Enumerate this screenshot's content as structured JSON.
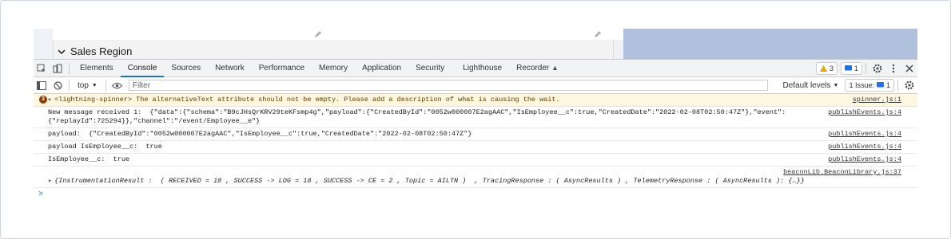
{
  "page": {
    "section_title": "Sales Region"
  },
  "devtools": {
    "tabs": [
      {
        "label": "Elements"
      },
      {
        "label": "Console"
      },
      {
        "label": "Sources"
      },
      {
        "label": "Network"
      },
      {
        "label": "Performance"
      },
      {
        "label": "Memory"
      },
      {
        "label": "Application"
      },
      {
        "label": "Security"
      },
      {
        "label": "Lighthouse"
      },
      {
        "label": "Recorder"
      }
    ],
    "warnings_count": "3",
    "messages_count": "1",
    "toolbar": {
      "context": "top",
      "filter_placeholder": "Filter",
      "levels_label": "Default levels",
      "issue_label": "1 Issue:",
      "issue_count": "1"
    },
    "console": {
      "warning": {
        "count": "3",
        "text": "<lightning-spinner> The alternativeText attribute should not be empty. Please add a description of what is causing the wait.",
        "source": "spinner.js:1"
      },
      "rows": [
        {
          "text": "New message received 1:  {\"data\":{\"schema\":\"B9cJHsQrKRV29teKFsmp4g\",\"payload\":{\"CreatedById\":\"0052w000007E2agAAC\",\"IsEmployee__c\":true,\"CreatedDate\":\"2022-02-08T02:50:47Z\"},\"event\":\n{\"replayId\":725294}},\"channel\":\"/event/Employee__e\"}",
          "source": "publishEvents.js:4"
        },
        {
          "text": "payload:  {\"CreatedById\":\"0052w000007E2agAAC\",\"IsEmployee__c\":true,\"CreatedDate\":\"2022-02-08T02:50:47Z\"}",
          "source": "publishEvents.js:4"
        },
        {
          "text": "payload IsEmployee__c:  true",
          "source": "publishEvents.js:4"
        },
        {
          "text": "IsEmployee__c:  true",
          "source": "publishEvents.js:4"
        }
      ],
      "beacon": {
        "source": "beaconLib.BeaconLibrary.js:37",
        "text": "{InstrumentationResult :  ( RECEIVED = 18 , SUCCESS -> LOG = 18 , SUCCESS -> CE = 2 , Topic = AILTN )  , TracingResponse : ( AsyncResults ) , TelemetryResponse : ( AsyncResults ): {…}}"
      },
      "prompt": ">"
    }
  }
}
